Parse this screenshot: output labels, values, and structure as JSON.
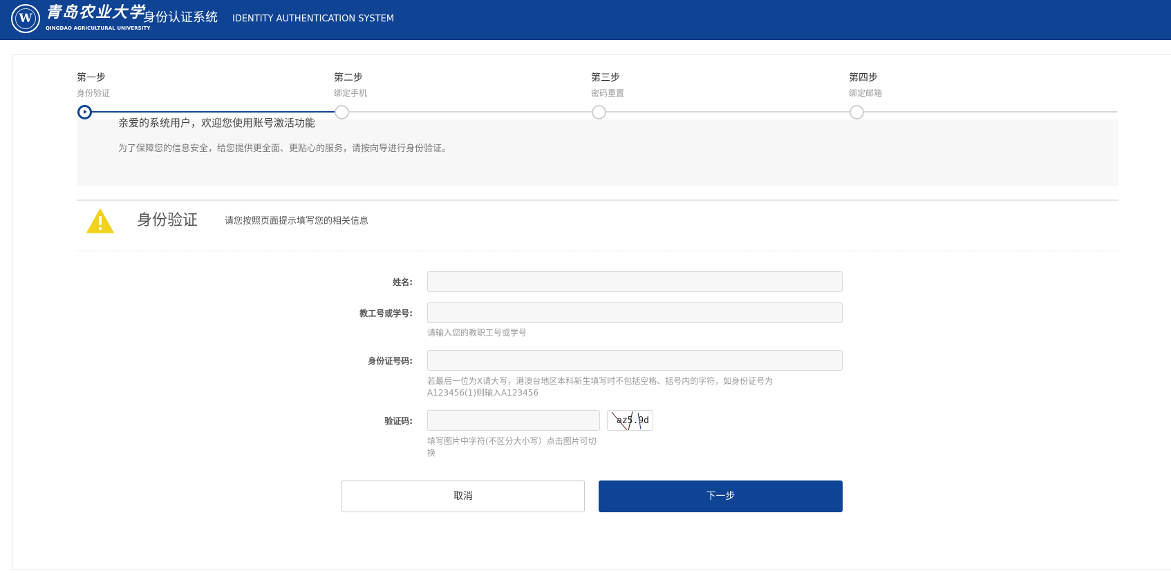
{
  "header": {
    "logo_seal_glyph": "W",
    "university_name_cn": "青岛农业大学",
    "university_name_en": "QINGDAO AGRICULTURAL UNIVERSITY",
    "system_title": "身份认证系统",
    "system_title_en": "IDENTITY AUTHENTICATION SYSTEM",
    "color": "#0f4394"
  },
  "steps": [
    {
      "title": "第一步",
      "subtitle": "身份验证",
      "active": true
    },
    {
      "title": "第二步",
      "subtitle": "绑定手机",
      "active": false
    },
    {
      "title": "第三步",
      "subtitle": "密码重置",
      "active": false
    },
    {
      "title": "第四步",
      "subtitle": "绑定邮箱",
      "active": false
    }
  ],
  "welcome": {
    "title": "亲爱的系统用户，欢迎您使用账号激活功能",
    "description": "为了保障您的信息安全，给您提供更全面、更贴心的服务，请按向导进行身份验证。"
  },
  "section": {
    "icon": "warning-icon",
    "title": "身份验证",
    "hint": "请您按照页面提示填写您的相关信息"
  },
  "form": {
    "name": {
      "label": "姓名:",
      "value": ""
    },
    "staff_id": {
      "label": "教工号或学号:",
      "value": "",
      "help": "请输入您的教职工号或学号"
    },
    "id_card": {
      "label": "身份证号码:",
      "value": "",
      "help_line1": "若最后一位为X请大写，港澳台地区本科新生填写时不包括空格、括号内的字符，如身份证号为",
      "help_line2": "A123456(1)则输入A123456"
    },
    "captcha": {
      "label": "验证码:",
      "value": "",
      "image_text": "az5.9d",
      "help_line1": "填写图片中字符(不区分大小写）点击图片可切",
      "help_line2": "换"
    }
  },
  "buttons": {
    "cancel": "取消",
    "next": "下一步"
  }
}
